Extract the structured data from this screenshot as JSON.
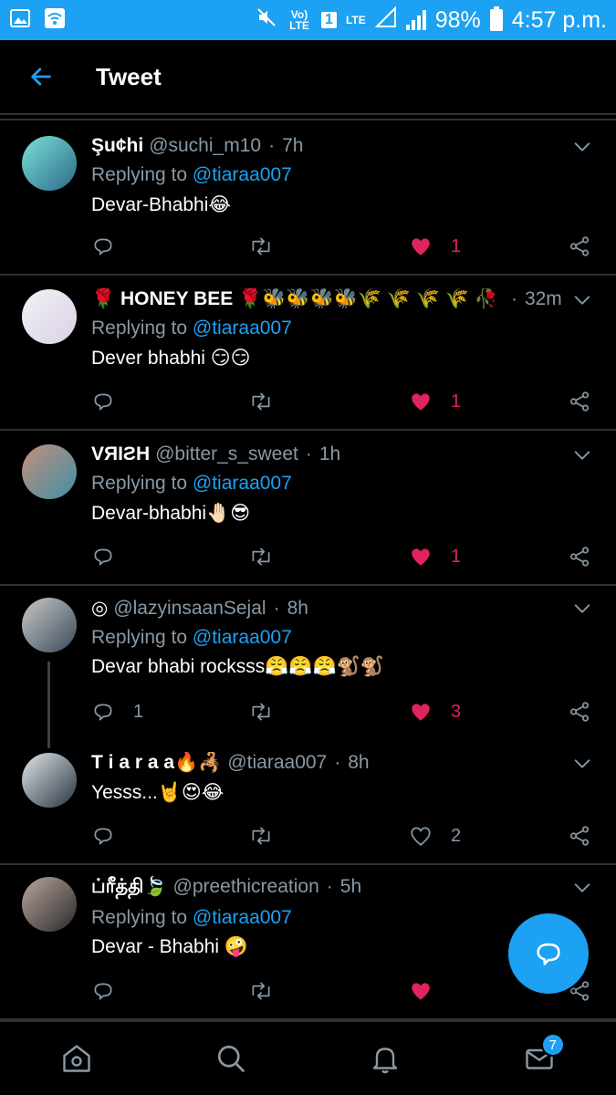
{
  "status_bar": {
    "volte": "Vo) LTE",
    "sim": "1",
    "lte": "LTE",
    "battery": "98%",
    "time": "4:57 p.m."
  },
  "header": {
    "title": "Tweet"
  },
  "tweets": [
    {
      "name": "Şu¢hi",
      "handle": "@suchi_m10",
      "sep": "·",
      "time": "7h",
      "replying": "Replying to",
      "mention": "@tiaraa007",
      "text": "Devar-Bhabhi😂",
      "replies": "",
      "likes": "1"
    },
    {
      "name": "🌹 HONEY BEE 🌹🐝🐝🐝🐝🌾 🌾 🌾 🌾 🥀",
      "handle": "",
      "sep": "·",
      "time": "32m",
      "replying": "Replying to",
      "mention": "@tiaraa007",
      "text": "Dever bhabhi 😏😏",
      "replies": "",
      "likes": "1"
    },
    {
      "name": "VЯIƧH",
      "handle": "@bitter_s_sweet",
      "sep": "·",
      "time": "1h",
      "replying": "Replying to",
      "mention": "@tiaraa007",
      "text": "Devar-bhabhi🤚🏻😎",
      "replies": "",
      "likes": "1"
    },
    {
      "name": "◎",
      "handle": "@lazyinsaanSejal",
      "sep": "·",
      "time": "8h",
      "replying": "Replying to",
      "mention": "@tiaraa007",
      "text": "Devar bhabi rocksss😤😤😤🐒🐒",
      "replies": "1",
      "likes": "3"
    },
    {
      "name": "T i a r a a🔥🦂",
      "handle": "@tiaraa007",
      "sep": "·",
      "time": "8h",
      "replying": "",
      "mention": "",
      "text": "Yesss...🤘😍😂",
      "replies": "",
      "likes": "2"
    },
    {
      "name": "ப்ரீத்தி🍃",
      "handle": "@preethicreation",
      "sep": "·",
      "time": "5h",
      "replying": "Replying to",
      "mention": "@tiaraa007",
      "text": "Devar - Bhabhi 🤪",
      "replies": "",
      "likes": ""
    }
  ],
  "bottom_nav": {
    "messages_badge": "7"
  },
  "colors": {
    "accent": "#1da1f2",
    "like": "#e0245e",
    "muted": "#8899a6",
    "divider": "#2f3336"
  }
}
